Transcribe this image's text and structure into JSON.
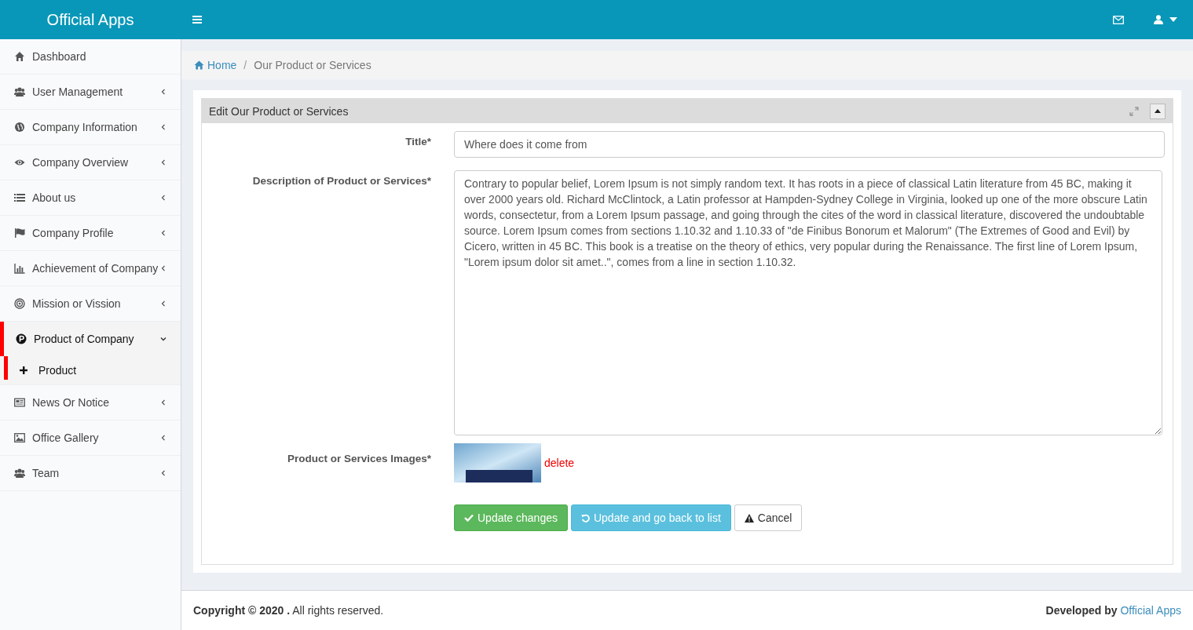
{
  "header": {
    "brand": "Official Apps"
  },
  "sidebar": {
    "items": [
      {
        "label": "Dashboard",
        "has_caret": false,
        "expanded": false,
        "selected": false
      },
      {
        "label": "User Management",
        "has_caret": true,
        "expanded": false,
        "selected": false
      },
      {
        "label": "Company Information",
        "has_caret": true,
        "expanded": false,
        "selected": false
      },
      {
        "label": "Company Overview",
        "has_caret": true,
        "expanded": false,
        "selected": false
      },
      {
        "label": "About us",
        "has_caret": true,
        "expanded": false,
        "selected": false
      },
      {
        "label": "Company Profile",
        "has_caret": true,
        "expanded": false,
        "selected": false
      },
      {
        "label": "Achievement of Company",
        "has_caret": true,
        "expanded": false,
        "selected": false
      },
      {
        "label": "Mission or Vission",
        "has_caret": true,
        "expanded": false,
        "selected": false
      },
      {
        "label": "Product of Company",
        "has_caret": true,
        "expanded": true,
        "selected": true,
        "children": [
          {
            "label": "Product",
            "selected": true
          }
        ]
      },
      {
        "label": "News Or Notice",
        "has_caret": true,
        "expanded": false,
        "selected": false
      },
      {
        "label": "Office Gallery",
        "has_caret": true,
        "expanded": false,
        "selected": false
      },
      {
        "label": "Team",
        "has_caret": true,
        "expanded": false,
        "selected": false
      }
    ]
  },
  "breadcrumb": [
    "Home",
    "Our Product or Services"
  ],
  "breadcrumb_separator": "/",
  "panel": {
    "title": "Edit Our Product or Services",
    "fields": [
      {
        "kind": "input",
        "label": "Title*",
        "value": "Where does it come from"
      },
      {
        "kind": "textarea",
        "label": "Description of Product or Services*",
        "value": "Contrary to popular belief, Lorem Ipsum is not simply random text. It has roots in a piece of classical Latin literature from 45 BC, making it over 2000 years old. Richard McClintock, a Latin professor at Hampden-Sydney College in Virginia, looked up one of the more obscure Latin words, consectetur, from a Lorem Ipsum passage, and going through the cites of the word in classical literature, discovered the undoubtable source. Lorem Ipsum comes from sections 1.10.32 and 1.10.33 of \"de Finibus Bonorum et Malorum\" (The Extremes of Good and Evil) by Cicero, written in 45 BC. This book is a treatise on the theory of ethics, very popular during the Renaissance. The first line of Lorem Ipsum, \"Lorem ipsum dolor sit amet..\", comes from a line in section 1.10.32."
      },
      {
        "kind": "image",
        "label": "Product or Services Images*",
        "action": "delete"
      }
    ],
    "buttons": [
      {
        "kind": "success",
        "label": "Update changes"
      },
      {
        "kind": "info",
        "label": "Update and go back to list"
      },
      {
        "kind": "default",
        "label": "Cancel"
      }
    ]
  },
  "footer": {
    "copyright": "**Copyright © 2020 .** All rights reserved.",
    "developed_by": "Developed by",
    "link": "Official Apps"
  }
}
